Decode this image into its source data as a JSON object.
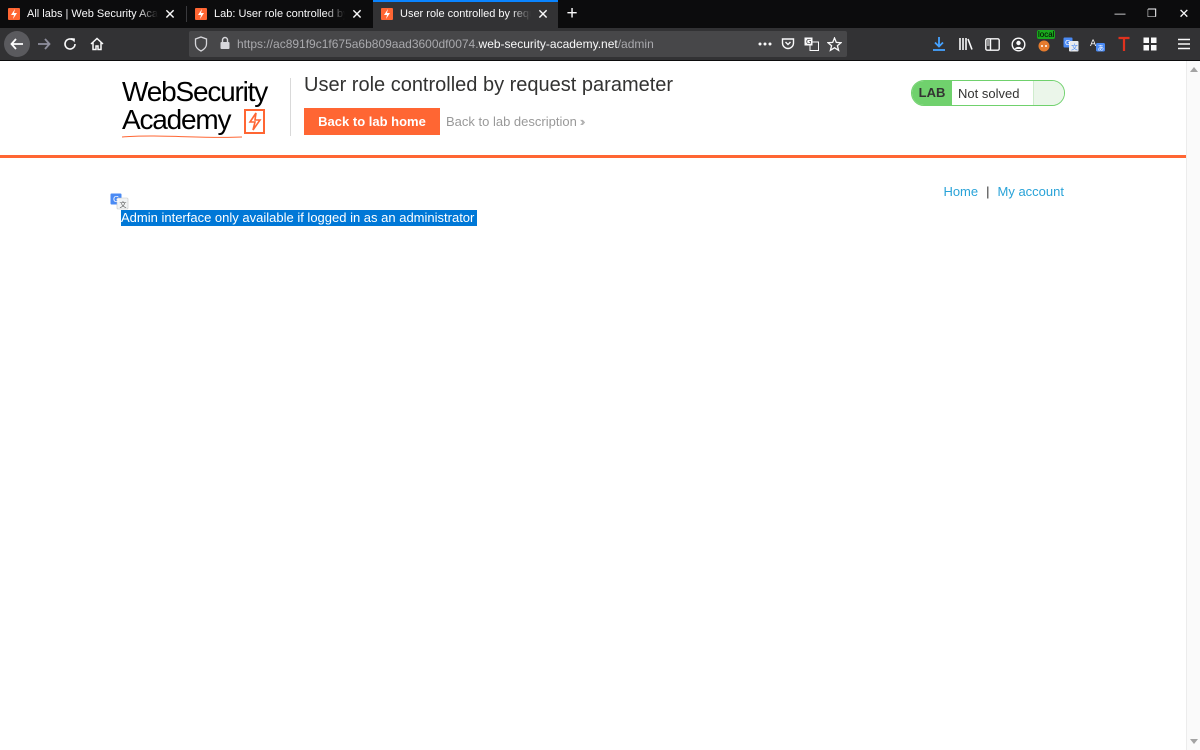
{
  "browser": {
    "tabs": [
      {
        "title": "All labs | Web Security Academy",
        "active": false
      },
      {
        "title": "Lab: User role controlled by request parameter",
        "active": false
      },
      {
        "title": "User role controlled by request parameter",
        "active": true
      }
    ],
    "url": {
      "prefix": "https://ac891f9c1f675a6b809aad3600df0074.",
      "host": "web-security-academy.net",
      "path": "/admin"
    },
    "extension_badge": "local"
  },
  "header": {
    "logo_line1": "WebSecurity",
    "logo_line2": "Academy",
    "title": "User role controlled by request parameter",
    "back_home_label": "Back to lab home",
    "back_desc_label": "Back to lab description",
    "status_badge": "LAB",
    "status_text": "Not solved"
  },
  "nav": {
    "home_label": "Home",
    "separator": "|",
    "account_label": "My account"
  },
  "content": {
    "message": "Admin interface only available if logged in as an administrator"
  },
  "colors": {
    "accent_orange": "#ff6633",
    "link_blue": "#29a3d8",
    "status_green": "#70d16d",
    "selection_blue": "#0078d7",
    "tab_active_bar": "#0a84ff"
  }
}
